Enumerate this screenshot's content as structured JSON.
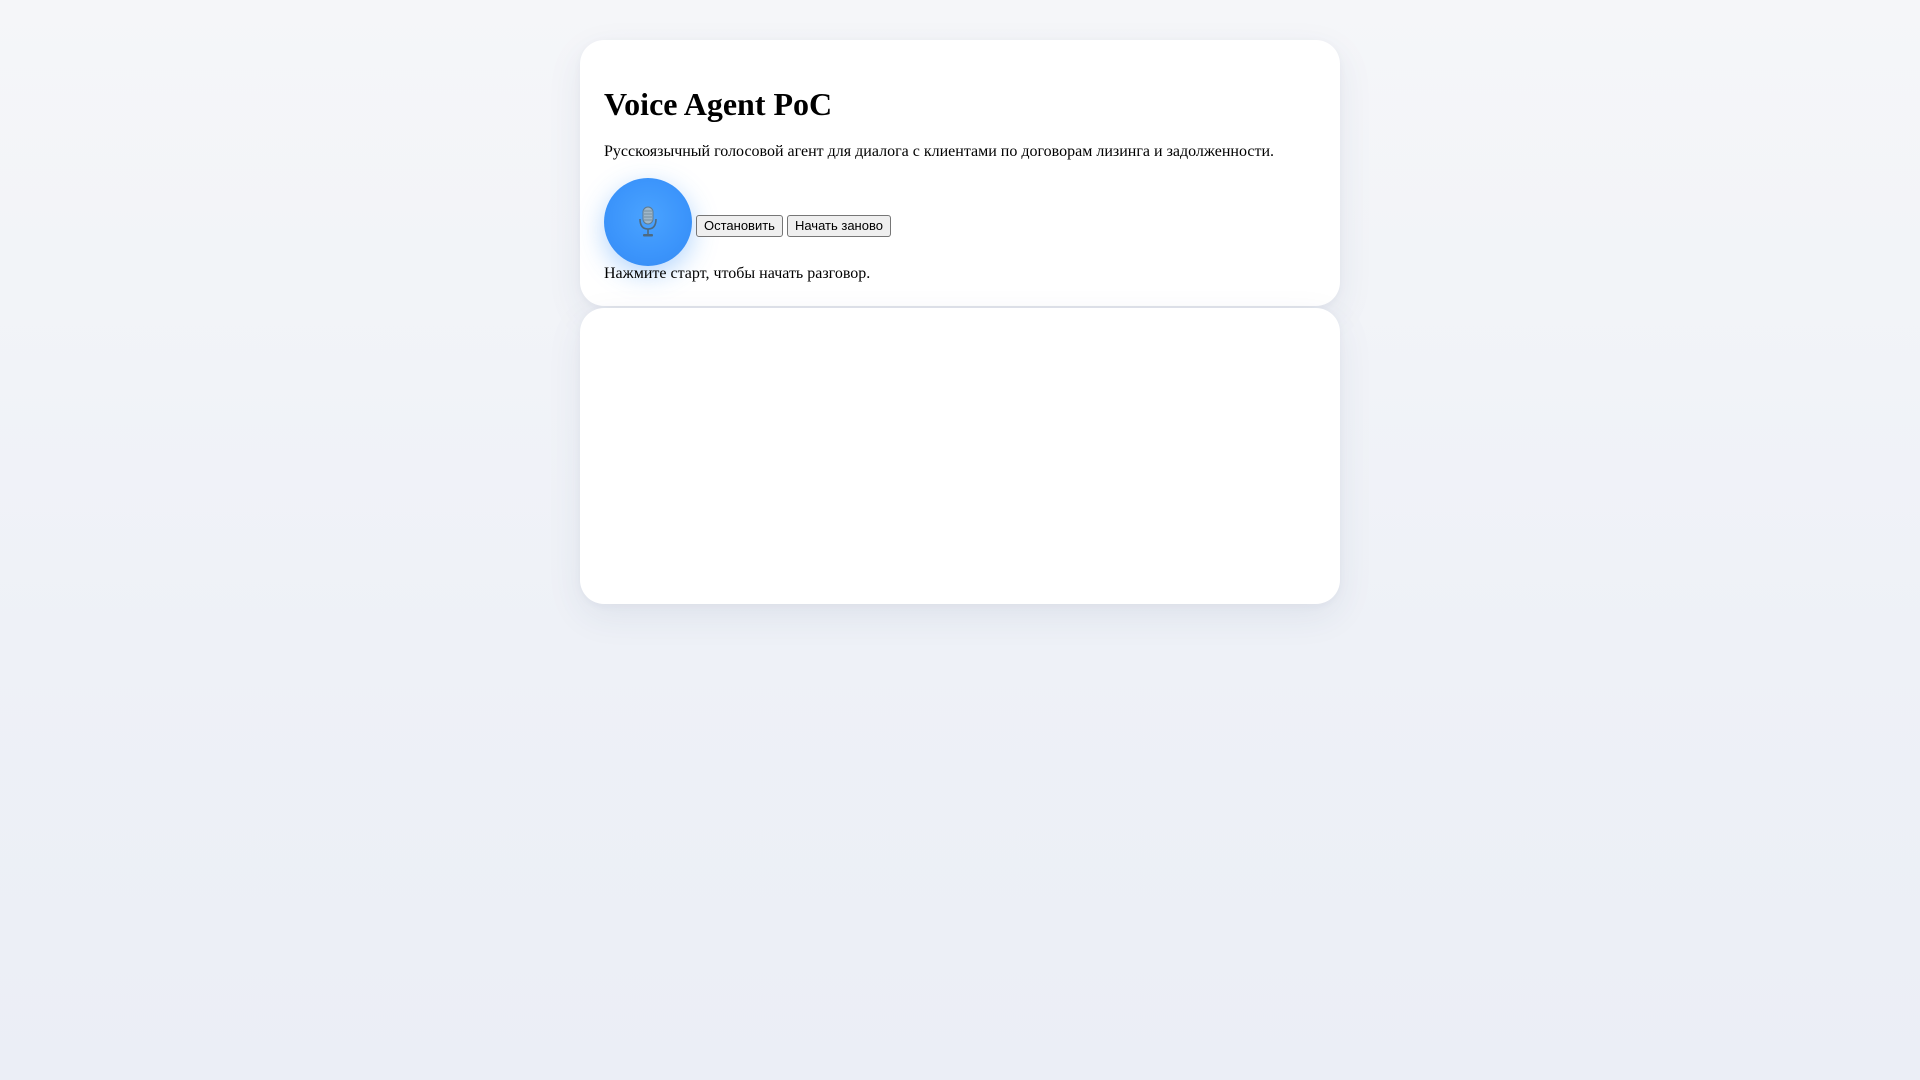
{
  "app": {
    "title": "Voice Agent PoC",
    "subtitle": "Русскоязычный голосовой агент для диалога с клиентами по договорам лизинга и задолженности."
  },
  "controls": {
    "mic_icon": "microphone-icon",
    "stop_label": "Остановить",
    "restart_label": "Начать заново"
  },
  "status": {
    "text": "Нажмите старт, чтобы начать разговор."
  },
  "colors": {
    "accent": "#3b94fb",
    "background": "#f2f4f8",
    "card": "#ffffff"
  }
}
